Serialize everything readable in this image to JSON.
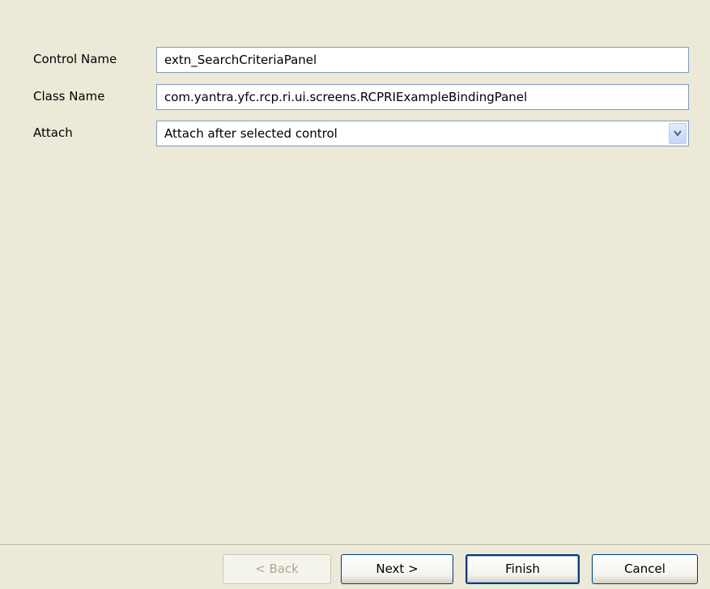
{
  "form": {
    "control_name_label": "Control Name",
    "control_name_value": "extn_SearchCriteriaPanel",
    "class_name_label": "Class Name",
    "class_name_value": "com.yantra.yfc.rcp.ri.ui.screens.RCPRIExampleBindingPanel",
    "attach_label": "Attach",
    "attach_selected": "Attach after selected control",
    "attach_arrow_icon": "chevron-down-icon"
  },
  "buttons": {
    "back_label": "< Back",
    "next_label": "Next >",
    "finish_label": "Finish",
    "cancel_label": "Cancel"
  },
  "colors": {
    "window_background": "#ECE9D8",
    "field_border": "#7F9DB9",
    "button_border": "#003C74",
    "disabled_text": "#ACA899"
  }
}
